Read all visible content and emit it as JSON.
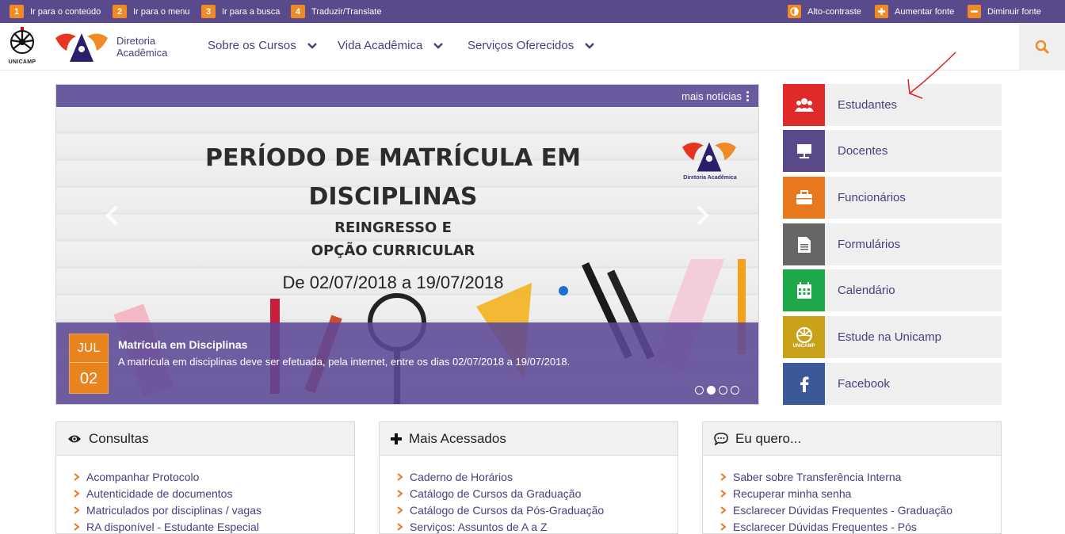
{
  "accessibility": {
    "items": [
      {
        "num": "1",
        "label": "Ir para o conteúdo"
      },
      {
        "num": "2",
        "label": "Ir para o menu"
      },
      {
        "num": "3",
        "label": "Ir para a busca"
      },
      {
        "num": "4",
        "label": "Traduzir/Translate"
      }
    ],
    "alto_contraste": "Alto-contraste",
    "aumentar_fonte": "Aumentar fonte",
    "diminuir_fonte": "Diminuir fonte"
  },
  "header": {
    "unicamp_label": "UNICAMP",
    "brand_line1": "Diretoria",
    "brand_line2": "Acadêmica",
    "nav": [
      "Sobre os Cursos",
      "Vida Acadêmica",
      "Serviços Oferecidos"
    ],
    "search_icon": "search-icon"
  },
  "carousel": {
    "more_news": "mais notícias",
    "slide": {
      "line1": "PERÍODO DE MATRÍCULA EM",
      "line2": "DISCIPLINAS",
      "line3": "REINGRESSO E",
      "line4": "OPÇÃO CURRICULAR",
      "dates": "De 02/07/2018 a 19/07/2018",
      "logo_text": "Diretoria Acadêmica"
    },
    "caption": {
      "month": "JUL",
      "day": "02",
      "title": "Matrícula em Disciplinas",
      "text": "A matrícula em disciplinas deve ser efetuada, pela internet, entre os dias 02/07/2018 a 19/07/2018."
    },
    "pages": 4,
    "active_page": 2
  },
  "side_menu": [
    {
      "label": "Estudantes",
      "color": "#e02a2a",
      "icon": "users-icon"
    },
    {
      "label": "Docentes",
      "color": "#5b4a8b",
      "icon": "presentation-icon"
    },
    {
      "label": "Funcionários",
      "color": "#e8781e",
      "icon": "briefcase-icon"
    },
    {
      "label": "Formulários",
      "color": "#666666",
      "icon": "document-icon"
    },
    {
      "label": "Calendário",
      "color": "#1fa84a",
      "icon": "calendar-icon"
    },
    {
      "label": "Estude na Unicamp",
      "color": "#c9a21a",
      "icon": "unicamp-icon"
    },
    {
      "label": "Facebook",
      "color": "#3b5998",
      "icon": "facebook-icon"
    }
  ],
  "panels": [
    {
      "title": "Consultas",
      "icon": "eye-icon",
      "links": [
        "Acompanhar Protocolo",
        "Autenticidade de documentos",
        "Matriculados por disciplinas / vagas",
        "RA disponível - Estudante Especial"
      ]
    },
    {
      "title": "Mais Acessados",
      "icon": "plus-icon",
      "links": [
        "Caderno de Horários",
        "Catálogo de Cursos da Graduação",
        "Catálogo de Cursos da Pós-Graduação",
        "Serviços: Assuntos de A a Z"
      ]
    },
    {
      "title": "Eu quero...",
      "icon": "comment-icon",
      "links": [
        "Saber sobre Transferência Interna",
        "Recuperar minha senha",
        "Esclarecer Dúvidas Frequentes - Graduação",
        "Esclarecer Dúvidas Frequentes - Pós"
      ]
    }
  ],
  "colors": {
    "purple": "#5b4a8b",
    "orange": "#f08a24",
    "link": "#4a3d7d"
  }
}
